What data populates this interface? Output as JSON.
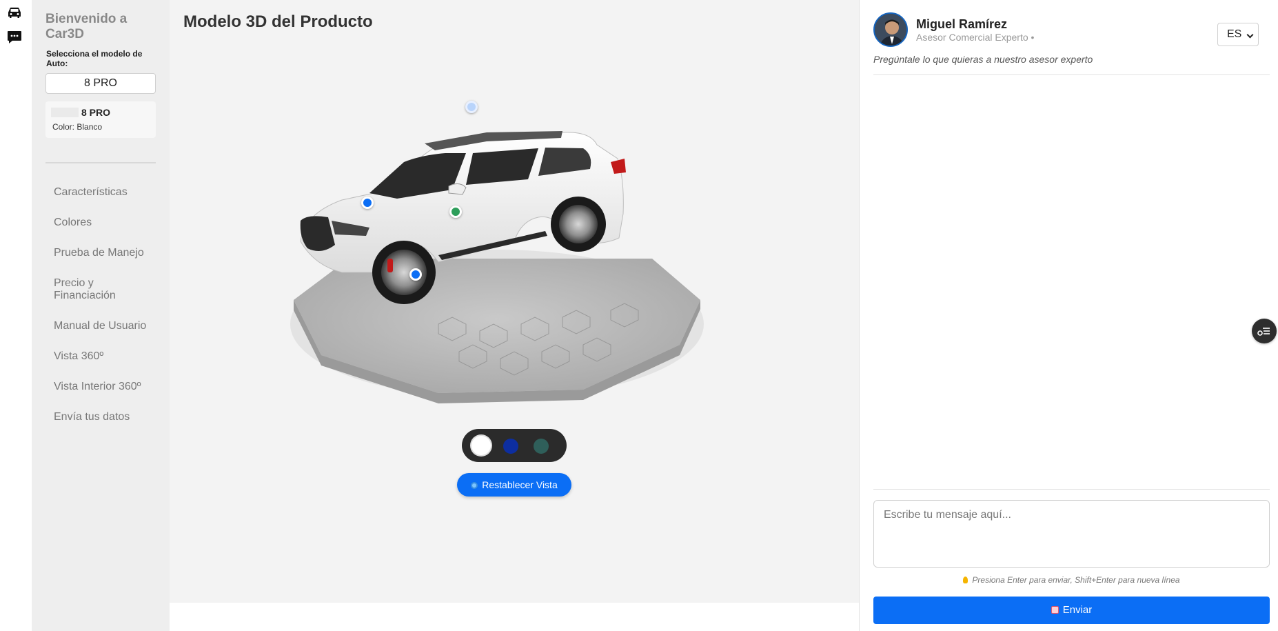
{
  "rail": {
    "icons": [
      "car-icon",
      "chat-bubble-icon"
    ]
  },
  "sidebar": {
    "title": "Bienvenido a Car3D",
    "select_label": "Selecciona el modelo de Auto:",
    "model_value": "8 PRO",
    "card": {
      "name": "8 PRO",
      "color": "Color: Blanco"
    },
    "nav": [
      {
        "label": "Características"
      },
      {
        "label": "Colores"
      },
      {
        "label": "Prueba de Manejo"
      },
      {
        "label": "Precio y Financiación"
      },
      {
        "label": "Manual de Usuario"
      },
      {
        "label": "Vista 360º"
      },
      {
        "label": "Vista Interior 360º"
      },
      {
        "label": "Envía tus datos"
      }
    ]
  },
  "main": {
    "title": "Modelo 3D del Producto",
    "colors": [
      "#ffffff",
      "#0d2ea0",
      "#2f5f5a"
    ],
    "selected_color": "#ffffff",
    "reset_label": "Restablecer Vista"
  },
  "chat": {
    "agent_name": "Miguel Ramírez",
    "agent_role": "Asesor Comercial Experto •",
    "language": "ES",
    "subtitle": "Pregúntale lo que quieras a nuestro asesor experto",
    "input_placeholder": "Escribe tu mensaje aquí...",
    "hint": "Presiona Enter para enviar, Shift+Enter para nueva línea",
    "send_label": "Enviar"
  },
  "colors": {
    "accent": "#0b6ef5",
    "sidebar_bg": "#eeeeee",
    "main_bg": "#f3f3f3",
    "hotspot_blue": "#0b6ef5",
    "hotspot_green": "#2e9e5b"
  }
}
